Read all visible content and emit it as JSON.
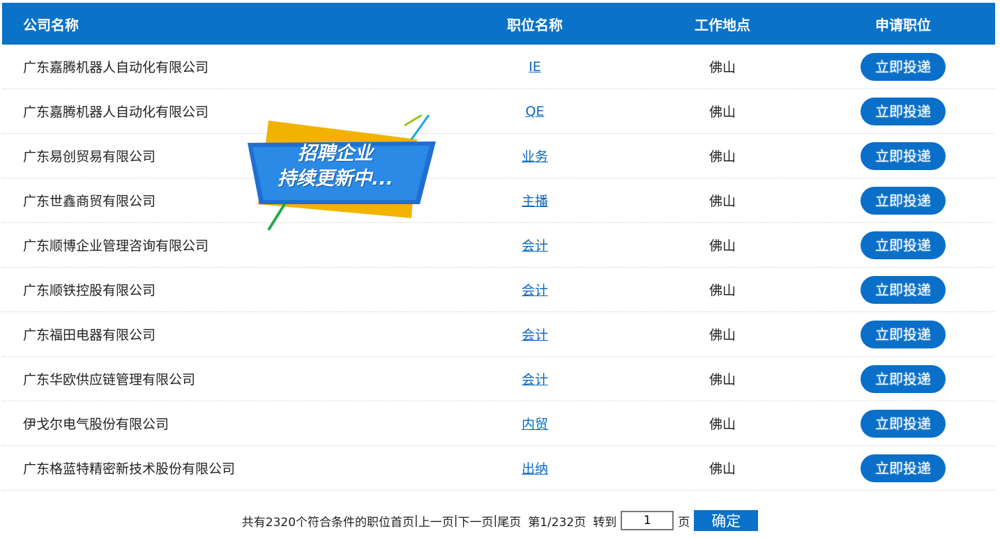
{
  "table": {
    "headers": {
      "company": "公司名称",
      "job": "职位名称",
      "location": "工作地点",
      "apply": "申请职位"
    },
    "rows": [
      {
        "company": "广东嘉腾机器人自动化有限公司",
        "job": "IE",
        "location": "佛山",
        "apply": "立即投递"
      },
      {
        "company": "广东嘉腾机器人自动化有限公司",
        "job": "QE",
        "location": "佛山",
        "apply": "立即投递"
      },
      {
        "company": "广东易创贸易有限公司",
        "job": "业务",
        "location": "佛山",
        "apply": "立即投递"
      },
      {
        "company": "广东世鑫商贸有限公司",
        "job": "主播",
        "location": "佛山",
        "apply": "立即投递"
      },
      {
        "company": "广东顺博企业管理咨询有限公司",
        "job": "会计",
        "location": "佛山",
        "apply": "立即投递"
      },
      {
        "company": "广东顺铁控股有限公司",
        "job": "会计",
        "location": "佛山",
        "apply": "立即投递"
      },
      {
        "company": "广东福田电器有限公司",
        "job": "会计",
        "location": "佛山",
        "apply": "立即投递"
      },
      {
        "company": "广东华欧供应链管理有限公司",
        "job": "会计",
        "location": "佛山",
        "apply": "立即投递"
      },
      {
        "company": "伊戈尔电气股份有限公司",
        "job": "内贸",
        "location": "佛山",
        "apply": "立即投递"
      },
      {
        "company": "广东格蓝特精密新技术股份有限公司",
        "job": "出纳",
        "location": "佛山",
        "apply": "立即投递"
      }
    ]
  },
  "banner": {
    "line1": "招聘企业",
    "line2": "持续更新中..."
  },
  "pager": {
    "summary": "共有2320个符合条件的职位",
    "first": "首页",
    "sep1": "|",
    "prev": "上一页",
    "sep2": "|",
    "next": "下一页",
    "sep3": "|",
    "last": "尾页",
    "page_info": "第1/232页",
    "goto_label": "转到",
    "goto_value": "1",
    "page_unit": "页",
    "confirm": "确定"
  },
  "colors": {
    "header_bg": "#0a72c8",
    "button_bg": "#0a6fc9",
    "link": "#0a67c2"
  }
}
